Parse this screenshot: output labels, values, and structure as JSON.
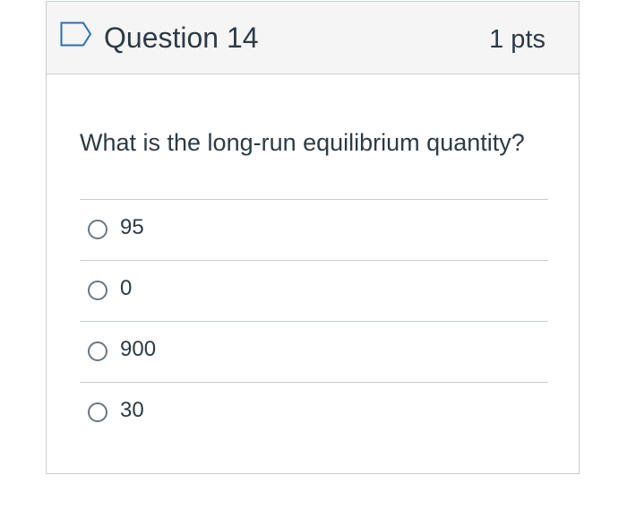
{
  "question": {
    "title": "Question 14",
    "points": "1 pts",
    "prompt": "What is the long-run equilibrium quantity?",
    "flag_icon": "flag-outline-icon",
    "answers": [
      {
        "label": "95",
        "selected": false
      },
      {
        "label": "0",
        "selected": false
      },
      {
        "label": "900",
        "selected": false
      },
      {
        "label": "30",
        "selected": false
      }
    ]
  },
  "colors": {
    "header_bg": "#f5f5f5",
    "border": "#c7cdd1",
    "text": "#2d3b45",
    "flag": "#2d6fb3"
  }
}
